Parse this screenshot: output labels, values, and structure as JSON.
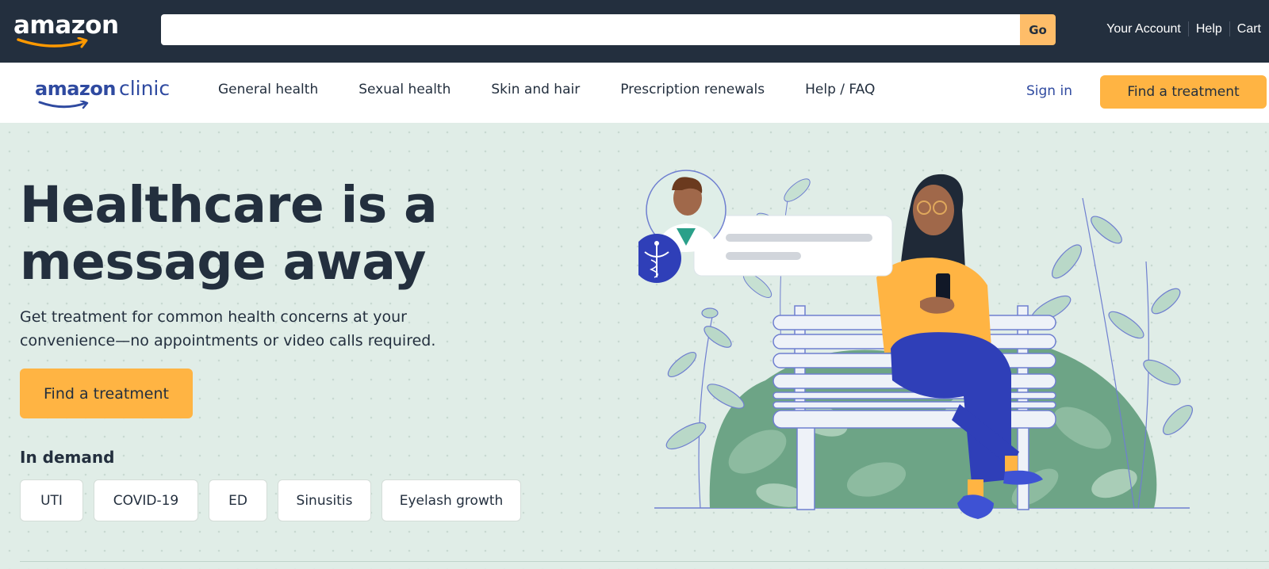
{
  "topbar": {
    "logo": "amazon",
    "search": {
      "value": "",
      "placeholder": ""
    },
    "go_label": "Go",
    "links": [
      "Your Account",
      "Help",
      "Cart"
    ]
  },
  "nav": {
    "logo_brand": "amazon",
    "logo_sub": "clinic",
    "items": [
      "General health",
      "Sexual health",
      "Skin and hair",
      "Prescription renewals",
      "Help / FAQ"
    ],
    "sign_in": "Sign in",
    "cta": "Find a treatment"
  },
  "hero": {
    "headline_line1": "Healthcare is a",
    "headline_line2": "message away",
    "subhead_line1": "Get treatment for common health concerns at your",
    "subhead_line2": "convenience—no appointments or video calls required.",
    "cta": "Find a treatment",
    "demand_title": "In demand",
    "chips": [
      "UTI",
      "COVID-19",
      "ED",
      "Sinusitis",
      "Eyelash growth"
    ]
  },
  "colors": {
    "topbar_bg": "#232f3e",
    "accent": "#ffb443",
    "brand_blue": "#2f4aa0",
    "hero_bg": "#e0ede7"
  }
}
